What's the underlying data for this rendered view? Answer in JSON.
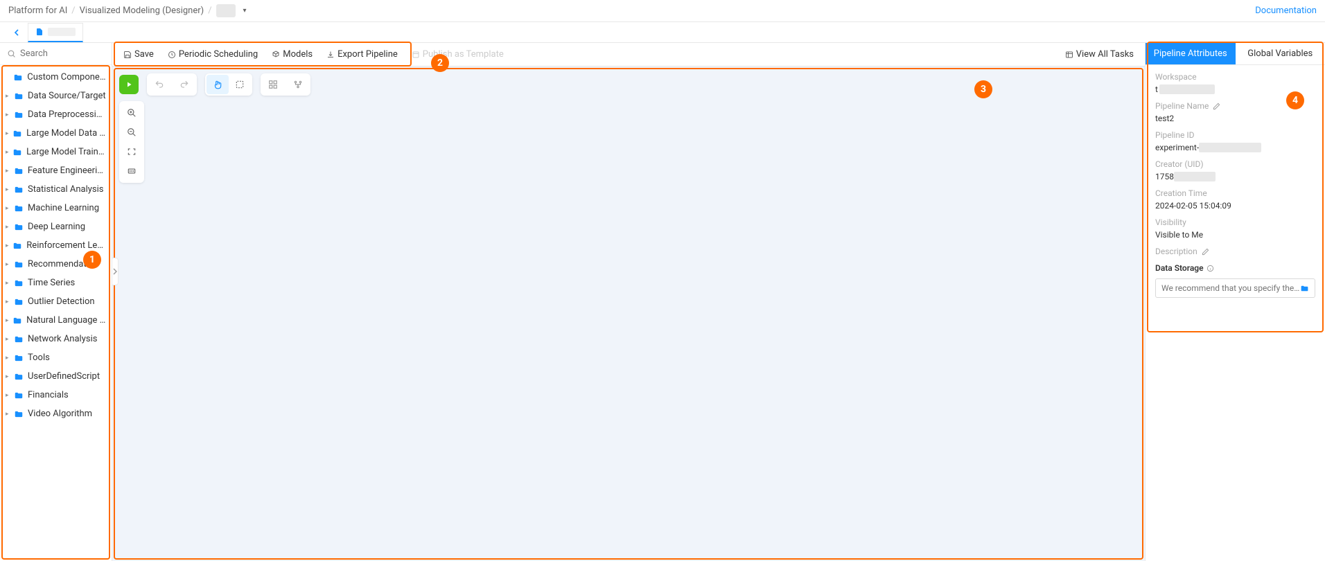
{
  "breadcrumb": {
    "root": "Platform for AI",
    "mid": "Visualized Modeling (Designer)"
  },
  "header": {
    "documentation": "Documentation"
  },
  "search": {
    "placeholder": "Search"
  },
  "sidebar": {
    "items": [
      {
        "label": "Custom Components",
        "expandable": false
      },
      {
        "label": "Data Source/Target",
        "expandable": true
      },
      {
        "label": "Data Preprocessing",
        "expandable": true
      },
      {
        "label": "Large Model Data Prep...",
        "expandable": true
      },
      {
        "label": "Large Model Training a...",
        "expandable": true
      },
      {
        "label": "Feature Engineering",
        "expandable": true
      },
      {
        "label": "Statistical Analysis",
        "expandable": true
      },
      {
        "label": "Machine Learning",
        "expandable": true
      },
      {
        "label": "Deep Learning",
        "expandable": true
      },
      {
        "label": "Reinforcement Learning",
        "expandable": true
      },
      {
        "label": "Recommendation",
        "expandable": true
      },
      {
        "label": "Time Series",
        "expandable": true
      },
      {
        "label": "Outlier Detection",
        "expandable": true
      },
      {
        "label": "Natural Language Proc...",
        "expandable": true
      },
      {
        "label": "Network Analysis",
        "expandable": true
      },
      {
        "label": "Tools",
        "expandable": true
      },
      {
        "label": "UserDefinedScript",
        "expandable": true
      },
      {
        "label": "Financials",
        "expandable": true
      },
      {
        "label": "Video Algorithm",
        "expandable": true
      }
    ]
  },
  "toolbar": {
    "save": "Save",
    "periodic": "Periodic Scheduling",
    "models": "Models",
    "export": "Export Pipeline",
    "publish": "Publish as Template",
    "view_all": "View All Tasks"
  },
  "right": {
    "tab_attrs": "Pipeline Attributes",
    "tab_globals": "Global Variables",
    "workspace_label": "Workspace",
    "workspace_value_prefix": "t",
    "pipeline_name_label": "Pipeline Name",
    "pipeline_name_value": "test2",
    "pipeline_id_label": "Pipeline ID",
    "pipeline_id_prefix": "experiment-",
    "creator_label": "Creator (UID)",
    "creator_prefix": "1758",
    "creation_time_label": "Creation Time",
    "creation_time_value": "2024-02-05 15:04:09",
    "visibility_label": "Visibility",
    "visibility_value": "Visible to Me",
    "description_label": "Description",
    "data_storage_label": "Data Storage",
    "data_storage_placeholder": "We recommend that you specify the path to s..."
  },
  "callouts": {
    "c1": "1",
    "c2": "2",
    "c3": "3",
    "c4": "4"
  }
}
